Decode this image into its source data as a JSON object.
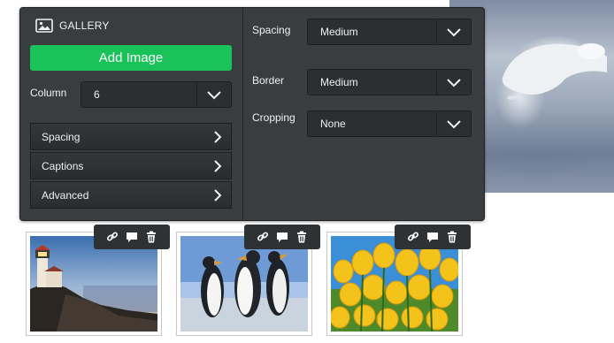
{
  "panel": {
    "title": "GALLERY",
    "add_button": "Add Image",
    "column_label": "Column",
    "column_value": "6",
    "accordion": [
      "Spacing",
      "Captions",
      "Advanced"
    ]
  },
  "right": {
    "spacing_label": "Spacing",
    "spacing_value": "Medium",
    "border_label": "Border",
    "border_value": "Medium",
    "cropping_label": "Cropping",
    "cropping_value": "None"
  },
  "thumbnails": [
    "lighthouse",
    "penguins",
    "tulips"
  ],
  "icons": [
    "image-icon",
    "chevron-down-icon",
    "chevron-right-icon",
    "link-icon",
    "caption-icon",
    "trash-icon"
  ],
  "colors": {
    "accent": "#1ac25a",
    "panel": "#3a3d3f",
    "field": "#2c2f31"
  }
}
